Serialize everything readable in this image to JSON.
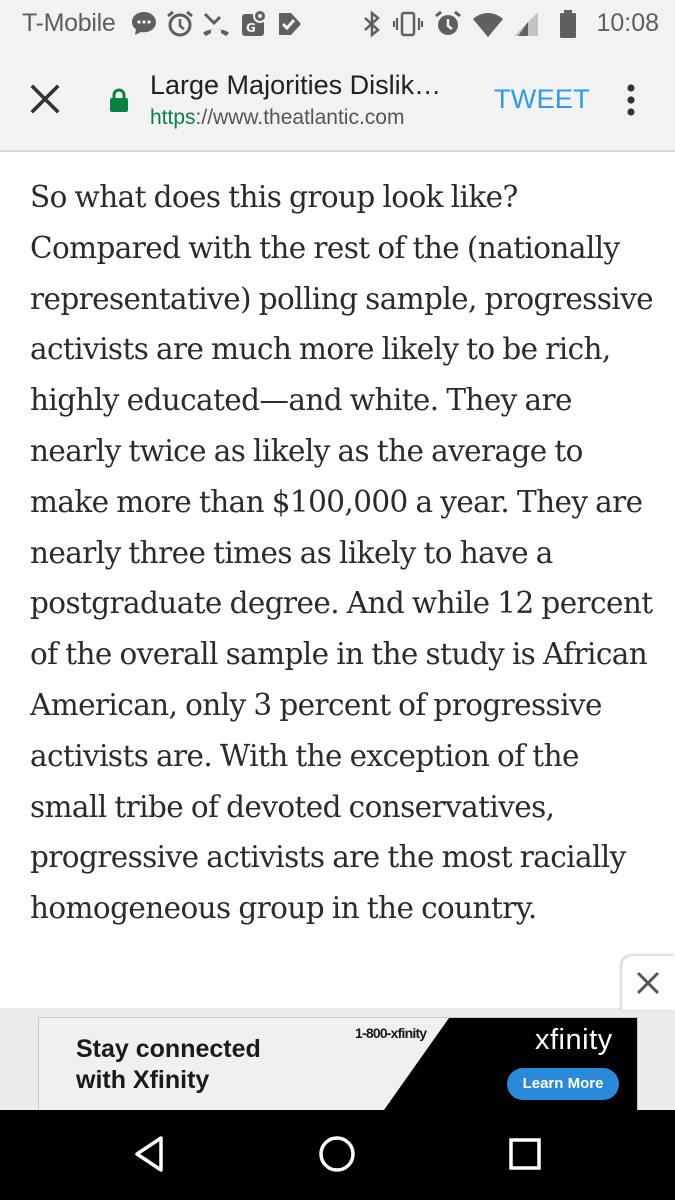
{
  "status_bar": {
    "carrier": "T-Mobile",
    "time": "10:08",
    "icons": [
      "chat-bubble-icon",
      "alarm-icon",
      "missed-call-icon",
      "maps-icon",
      "check-flag-icon",
      "bluetooth-icon",
      "vibrate-icon",
      "alarm-icon",
      "wifi-icon",
      "signal-icon",
      "battery-icon"
    ]
  },
  "toolbar": {
    "title": "Large Majorities Dislik…",
    "url_scheme": "https",
    "url_rest": "://www.theatlantic.com",
    "tweet_label": "TWEET",
    "lock_color": "#0b8043",
    "tweet_color": "#2d9be6"
  },
  "article": {
    "paragraph": "So what does this group look like? Compared with the rest of the (nationally representative) polling sample, progressive activists are much more likely to be rich, highly educated—and white. They are nearly twice as likely as the average to make more than $100,000 a year. They are nearly three times as likely to have a postgraduate degree. And while 12 percent of the overall sample in the study is African American, only 3 percent of progressive activists are. With the exception of the small tribe of devoted conservatives, progressive activists are the most racially homogeneous group in the country."
  },
  "ad": {
    "headline_line1": "Stay connected",
    "headline_line2": "with Xfinity",
    "phone": "1-800-xfinity",
    "brand": "xfinity",
    "cta": "Learn More",
    "cta_color": "#2a8ad9"
  },
  "navigation": {
    "buttons": [
      "back-icon",
      "home-icon",
      "recents-icon"
    ]
  }
}
